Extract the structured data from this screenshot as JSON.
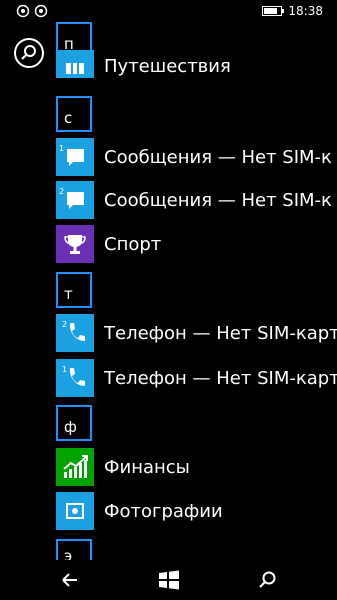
{
  "status": {
    "time": "18:38"
  },
  "headers": {
    "p": "п",
    "s": "с",
    "t": "т",
    "f": "ф",
    "e": "э"
  },
  "apps": {
    "travel": "Путешествия",
    "messages1": "Сообщения — Нет SIM-к",
    "messages2": "Сообщения — Нет SIM-к",
    "sport": "Спорт",
    "phone2": "Телефон — Нет SIM-карт",
    "phone1": "Телефон — Нет SIM-карт",
    "finance": "Финансы",
    "photos": "Фотографии"
  },
  "tile_badges": {
    "msg1": "1",
    "msg2": "2",
    "ph2": "2",
    "ph1": "1"
  },
  "colors": {
    "accent": "#1e90ff",
    "tile_blue": "#1ba1e2",
    "tile_purple": "#6b2fb5",
    "tile_green": "#00a300"
  },
  "icons": [
    "sim-1-icon",
    "sim-2-icon",
    "battery-icon",
    "search-icon",
    "back-icon",
    "windows-start-icon",
    "search-nav-icon"
  ]
}
